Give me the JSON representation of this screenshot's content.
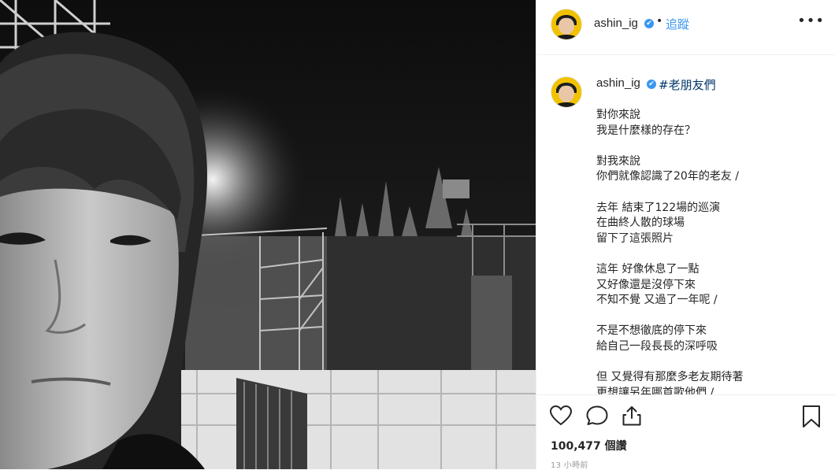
{
  "post": {
    "username": "ashin_ig",
    "verified_mark": "✔",
    "separator": "•",
    "follow_label": "追蹤",
    "more_label": "•••"
  },
  "caption": {
    "username": "ashin_ig",
    "hashtag": "#老朋友們",
    "lines": [
      "對你來說",
      "我是什麼樣的存在？",
      "",
      "對我來說",
      "你們就像認識了20年的老友 /",
      "",
      "去年 結束了122場的巡演",
      "在曲終人散的球場",
      "留下了這張照片",
      "",
      "這年 好像休息了一點",
      "又好像還是沒停下來",
      "不知不覺 又過了一年呢 /",
      "",
      "不是不想徹底的停下來",
      "給自己一段長長的深呼吸",
      "",
      "但 又覺得有那麼多老友期待著",
      "更想讓另年哪首歌他們 /"
    ]
  },
  "actions": {
    "like_icon": "heart-icon",
    "comment_icon": "comment-icon",
    "share_icon": "share-icon",
    "save_icon": "bookmark-icon",
    "likes_text": "100,477 個讚",
    "timestamp": "13 小時前"
  },
  "colors": {
    "link_blue": "#3897f0",
    "hashtag_blue": "#003569",
    "text": "#262626",
    "muted": "#999999",
    "avatar_bg": "#f2c200"
  }
}
